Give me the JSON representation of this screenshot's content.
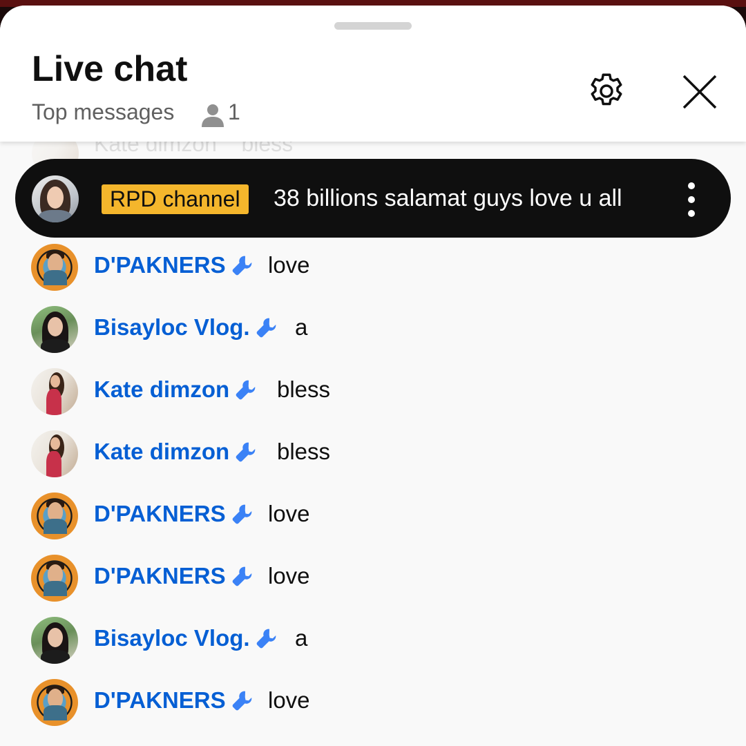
{
  "header": {
    "title": "Live chat",
    "subtitle": "Top messages",
    "viewer_count": "1",
    "icons": {
      "viewers": "person-icon",
      "settings": "gear-icon",
      "close": "close-icon"
    }
  },
  "ghost_message": {
    "author": "Kate dimzon",
    "text": "bless"
  },
  "pinned": {
    "badge": "RPD channel",
    "message": "38 billions salamat guys love u all",
    "more_icon": "more-vert-icon"
  },
  "messages": [
    {
      "author": "D'PAKNERS",
      "text": "love",
      "avatar": "bingo"
    },
    {
      "author": "Bisayloc Vlog.",
      "text": "a",
      "avatar": "girl"
    },
    {
      "author": "Kate dimzon",
      "text": "bless",
      "avatar": "kate"
    },
    {
      "author": "Kate dimzon",
      "text": "bless",
      "avatar": "kate"
    },
    {
      "author": "D'PAKNERS",
      "text": "love",
      "avatar": "bingo"
    },
    {
      "author": "D'PAKNERS",
      "text": "love",
      "avatar": "bingo"
    },
    {
      "author": "Bisayloc Vlog.",
      "text": "a",
      "avatar": "girl"
    },
    {
      "author": "D'PAKNERS",
      "text": "love",
      "avatar": "bingo"
    }
  ],
  "colors": {
    "author": "#065fd4",
    "badge_bg": "#f4b62c",
    "pinned_bg": "#0f0f0f",
    "moderator_wrench": "#3b82f6"
  }
}
